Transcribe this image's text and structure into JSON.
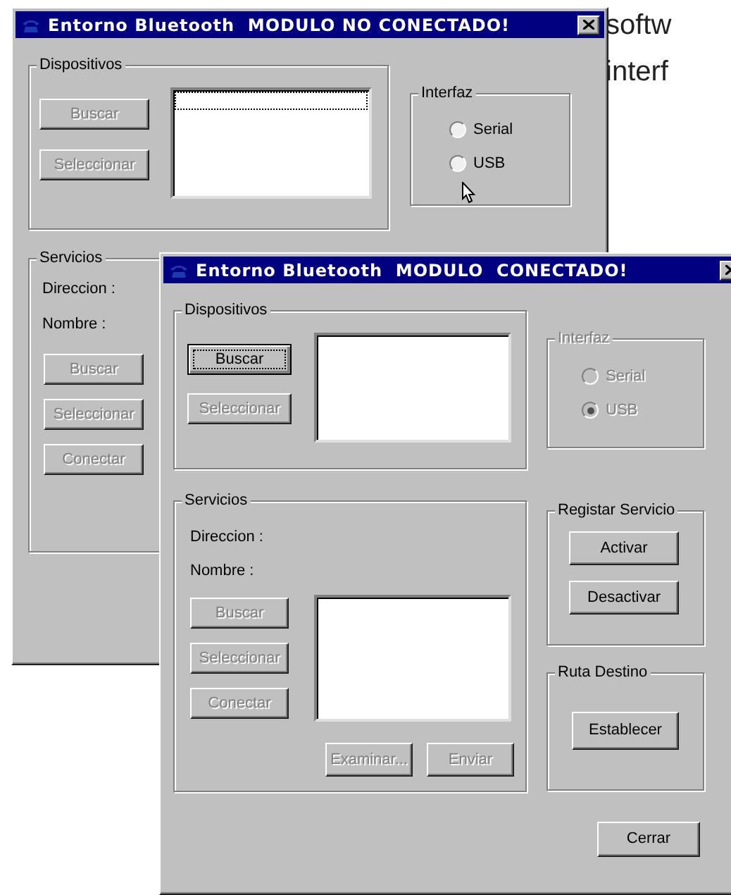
{
  "document_text": [
    "softw",
    "interf"
  ],
  "windows": [
    {
      "title": "Entorno Bluetooth  MODULO NO CONECTADO!",
      "devices": {
        "label": "Dispositivos",
        "buttons": [
          {
            "label": "Buscar",
            "disabled": true,
            "focused": false
          },
          {
            "label": "Seleccionar",
            "disabled": true,
            "focused": false
          }
        ],
        "list": {
          "focused": true
        }
      },
      "interface": {
        "label": "Interfaz",
        "disabled": false,
        "options": [
          {
            "label": "Serial",
            "selected": false
          },
          {
            "label": "USB",
            "selected": false
          }
        ]
      },
      "services": {
        "label": "Servicios",
        "fields": [
          "Direccion :",
          "Nombre :"
        ],
        "buttons": [
          {
            "label": "Buscar",
            "disabled": true,
            "focused": false
          },
          {
            "label": "Seleccionar",
            "disabled": true,
            "focused": false
          },
          {
            "label": "Conectar",
            "disabled": true,
            "focused": false
          }
        ]
      }
    },
    {
      "title": "Entorno Bluetooth  MODULO  CONECTADO!",
      "devices": {
        "label": "Dispositivos",
        "buttons": [
          {
            "label": "Buscar",
            "disabled": false,
            "focused": true
          },
          {
            "label": "Seleccionar",
            "disabled": true,
            "focused": false
          }
        ],
        "list": {
          "focused": false
        }
      },
      "interface": {
        "label": "Interfaz",
        "disabled": true,
        "options": [
          {
            "label": "Serial",
            "selected": false
          },
          {
            "label": "USB",
            "selected": true
          }
        ]
      },
      "services": {
        "label": "Servicios",
        "fields": [
          "Direccion :",
          "Nombre :"
        ],
        "buttons": [
          {
            "label": "Buscar",
            "disabled": true,
            "focused": false
          },
          {
            "label": "Seleccionar",
            "disabled": true,
            "focused": false
          },
          {
            "label": "Conectar",
            "disabled": true,
            "focused": false
          }
        ],
        "list": {
          "focused": false
        },
        "actions": [
          {
            "label": "Examinar...",
            "disabled": true,
            "focused": false
          },
          {
            "label": "Enviar",
            "disabled": true,
            "focused": false
          }
        ]
      },
      "register": {
        "label": "Registar Servicio",
        "buttons": [
          {
            "label": "Activar",
            "disabled": false,
            "focused": false
          },
          {
            "label": "Desactivar",
            "disabled": false,
            "focused": false
          }
        ]
      },
      "route": {
        "label": "Ruta Destino",
        "buttons": [
          {
            "label": "Establecer",
            "disabled": false,
            "focused": false
          }
        ]
      },
      "close_button": {
        "label": "Cerrar",
        "disabled": false,
        "focused": false
      }
    }
  ]
}
